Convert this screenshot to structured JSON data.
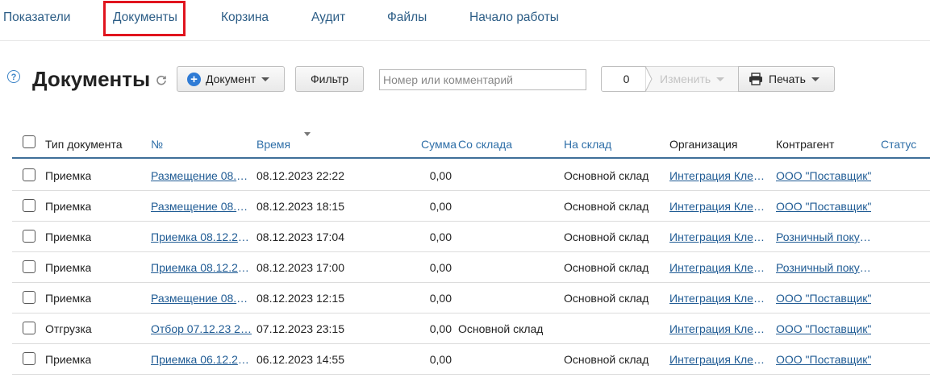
{
  "nav": {
    "tabs": [
      {
        "label": "Показатели"
      },
      {
        "label": "Документы"
      },
      {
        "label": "Корзина"
      },
      {
        "label": "Аудит"
      },
      {
        "label": "Файлы"
      },
      {
        "label": "Начало работы"
      }
    ]
  },
  "toolbar": {
    "help_symbol": "?",
    "title": "Документы",
    "document_button": "Документ",
    "filter_button": "Фильтр",
    "search_placeholder": "Номер или комментарий",
    "selected_count": "0",
    "edit_button": "Изменить",
    "print_button": "Печать"
  },
  "table": {
    "columns": {
      "type": "Тип документа",
      "number": "№",
      "time": "Время",
      "sum": "Сумма",
      "from_store": "Со склада",
      "to_store": "На склад",
      "org": "Организация",
      "counterparty": "Контрагент",
      "status": "Статус"
    },
    "rows": [
      {
        "type": "Приемка",
        "number": "Размещение 08.1…",
        "time": "08.12.2023 22:22",
        "sum": "0,00",
        "from_store": "",
        "to_store": "Основной склад",
        "org": "Интеграция Клев…",
        "counterparty": "ООО \"Поставщик\""
      },
      {
        "type": "Приемка",
        "number": "Размещение 08.1…",
        "time": "08.12.2023 18:15",
        "sum": "0,00",
        "from_store": "",
        "to_store": "Основной склад",
        "org": "Интеграция Клев…",
        "counterparty": "ООО \"Поставщик\""
      },
      {
        "type": "Приемка",
        "number": "Приемка 08.12.23…",
        "time": "08.12.2023 17:04",
        "sum": "0,00",
        "from_store": "",
        "to_store": "Основной склад",
        "org": "Интеграция Клев…",
        "counterparty": "Розничный покуп…"
      },
      {
        "type": "Приемка",
        "number": "Приемка 08.12.23…",
        "time": "08.12.2023 17:00",
        "sum": "0,00",
        "from_store": "",
        "to_store": "Основной склад",
        "org": "Интеграция Клев…",
        "counterparty": "Розничный покуп…"
      },
      {
        "type": "Приемка",
        "number": "Размещение 08.1…",
        "time": "08.12.2023 12:15",
        "sum": "0,00",
        "from_store": "",
        "to_store": "Основной склад",
        "org": "Интеграция Клев…",
        "counterparty": "ООО \"Поставщик\""
      },
      {
        "type": "Отгрузка",
        "number": "Отбор 07.12.23 2…",
        "time": "07.12.2023 23:15",
        "sum": "0,00",
        "from_store": "Основной склад",
        "to_store": "",
        "org": "Интеграция Клев…",
        "counterparty": "ООО \"Поставщик\""
      },
      {
        "type": "Приемка",
        "number": "Приемка 06.12.23…",
        "time": "06.12.2023 14:55",
        "sum": "0,00",
        "from_store": "",
        "to_store": "Основной склад",
        "org": "Интеграция Клев…",
        "counterparty": "ООО \"Поставщик\""
      }
    ]
  },
  "colors": {
    "link": "#1f5b94",
    "highlight_box": "#e0141e",
    "header_rule": "#3f6f99",
    "plus_icon": "#2f7bd5"
  }
}
